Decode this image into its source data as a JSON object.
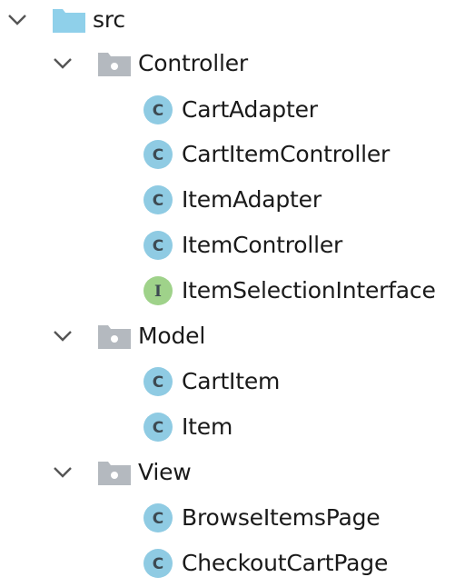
{
  "colors": {
    "chevron": "#555555",
    "src_folder": "#8fd0ea",
    "package_folder": "#b4b9bf",
    "class_badge": "#8fcbe3",
    "interface_badge": "#9fd28a",
    "badge_letter": "#3d4a52",
    "text": "#1a1a1a"
  },
  "tree": {
    "root": {
      "label": "src",
      "icon": "folder-icon",
      "expanded": true
    },
    "packages": [
      {
        "label": "Controller",
        "icon": "package-icon",
        "expanded": true,
        "items": [
          {
            "label": "CartAdapter",
            "kind": "class",
            "badge": "C"
          },
          {
            "label": "CartItemController",
            "kind": "class",
            "badge": "C"
          },
          {
            "label": "ItemAdapter",
            "kind": "class",
            "badge": "C"
          },
          {
            "label": "ItemController",
            "kind": "class",
            "badge": "C"
          },
          {
            "label": "ItemSelectionInterface",
            "kind": "interface",
            "badge": "I"
          }
        ]
      },
      {
        "label": "Model",
        "icon": "package-icon",
        "expanded": true,
        "items": [
          {
            "label": "CartItem",
            "kind": "class",
            "badge": "C"
          },
          {
            "label": "Item",
            "kind": "class",
            "badge": "C"
          }
        ]
      },
      {
        "label": "View",
        "icon": "package-icon",
        "expanded": true,
        "items": [
          {
            "label": "BrowseItemsPage",
            "kind": "class",
            "badge": "C"
          },
          {
            "label": "CheckoutCartPage",
            "kind": "class",
            "badge": "C"
          }
        ]
      }
    ]
  }
}
